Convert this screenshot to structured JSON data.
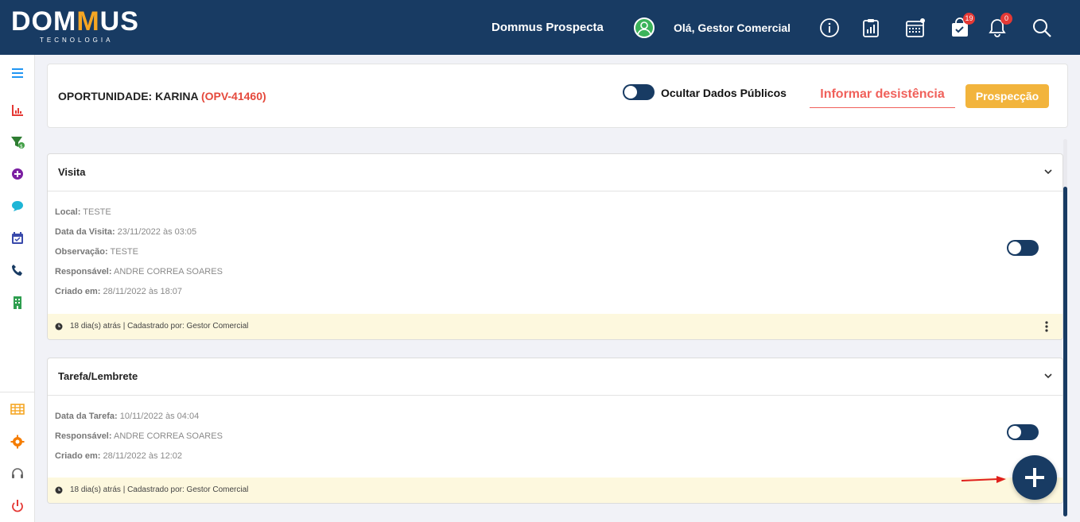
{
  "header": {
    "logo_main_pre": "DOM",
    "logo_main_m": "M",
    "logo_main_post": "US",
    "logo_sub": "TECNOLOGIA",
    "app_name": "Dommus Prospecta",
    "greeting": "Olá, Gestor Comercial",
    "cart_badge": "19",
    "bell_badge": "0"
  },
  "opportunity": {
    "title_prefix": "OPORTUNIDADE: KARINA",
    "code": "(OPV-41460)",
    "hide_public_label": "Ocultar Dados Públicos",
    "desist_label": "Informar desistência",
    "stage_label": "Prospecção"
  },
  "visita": {
    "title": "Visita",
    "fields": [
      {
        "label": "Local:",
        "value": "TESTE"
      },
      {
        "label": "Data da Visita:",
        "value": "23/11/2022 às 03:05"
      },
      {
        "label": "Observação:",
        "value": "TESTE"
      },
      {
        "label": "Responsável:",
        "value": "ANDRE CORREA SOARES"
      },
      {
        "label": "Criado em:",
        "value": "28/11/2022 às 18:07"
      }
    ],
    "footer": "18 dia(s) atrás | Cadastrado por: Gestor Comercial"
  },
  "tarefa": {
    "title": "Tarefa/Lembrete",
    "fields": [
      {
        "label": "Data da Tarefa:",
        "value": "10/11/2022 às 04:04"
      },
      {
        "label": "Responsável:",
        "value": "ANDRE CORREA SOARES"
      },
      {
        "label": "Criado em:",
        "value": "28/11/2022 às 12:02"
      }
    ],
    "footer": "18 dia(s) atrás | Cadastrado por: Gestor Comercial"
  },
  "colors": {
    "primary": "#183b63",
    "accent_red": "#e5493c",
    "accent_yellow": "#f2b43c",
    "footer_bg": "#fdf8de"
  }
}
